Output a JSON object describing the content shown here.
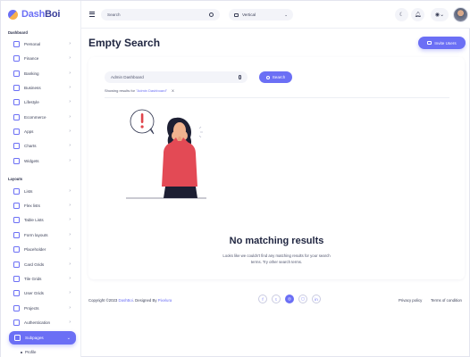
{
  "brand": {
    "name_part1": "Dash",
    "name_part2": "Boi"
  },
  "sidebar": {
    "section_dashboard": "Dashboard",
    "dashboard_items": [
      {
        "label": "Personal",
        "icon": "home-icon"
      },
      {
        "label": "Finance",
        "icon": "finance-icon"
      },
      {
        "label": "Banking",
        "icon": "bank-icon"
      },
      {
        "label": "Business",
        "icon": "briefcase-icon"
      },
      {
        "label": "Lifestyle",
        "icon": "lifestyle-icon"
      },
      {
        "label": "Ecommerce",
        "icon": "cart-icon"
      },
      {
        "label": "Apps",
        "icon": "apps-icon"
      },
      {
        "label": "Charts",
        "icon": "chart-icon"
      },
      {
        "label": "Widgets",
        "icon": "widget-icon"
      }
    ],
    "section_layouts": "Layouts",
    "layout_items": [
      {
        "label": "Lists",
        "icon": "list-icon"
      },
      {
        "label": "Flex lists",
        "icon": "flex-list-icon"
      },
      {
        "label": "Table Lists",
        "icon": "table-icon"
      },
      {
        "label": "Form layouts",
        "icon": "form-icon"
      },
      {
        "label": "Placeholder",
        "icon": "placeholder-icon"
      },
      {
        "label": "Card Grids",
        "icon": "card-grid-icon"
      },
      {
        "label": "Tile Grids",
        "icon": "tile-grid-icon"
      },
      {
        "label": "User Grids",
        "icon": "user-grid-icon"
      },
      {
        "label": "Projects",
        "icon": "project-icon"
      },
      {
        "label": "Authentication",
        "icon": "auth-icon"
      }
    ],
    "active_item": "Subpages",
    "sub_item": "Profile"
  },
  "topbar": {
    "search_placeholder": "Search",
    "layout_select": "Vertical"
  },
  "page": {
    "title": "Empty Search",
    "invite_button": "Invite Users"
  },
  "search": {
    "query": "Admin Dashboard",
    "button": "Search",
    "showing_prefix": "Showing results for",
    "showing_query": "\"Admin Dashboard\"",
    "clear": "X"
  },
  "empty": {
    "title": "No matching results",
    "description": "Looks like we couldn't find any matching results for your search terms. Try other search terms."
  },
  "footer": {
    "copyright_prefix": "Copyright ©2023",
    "copyright_brand": "DashBoi",
    "copyright_mid": ". Designed By",
    "designer": "Pixelura",
    "privacy": "Privacy policy",
    "terms": "Terms of condition",
    "socials": [
      {
        "icon": "facebook-icon",
        "glyph": "f"
      },
      {
        "icon": "twitter-icon",
        "glyph": "t"
      },
      {
        "icon": "dribbble-icon",
        "glyph": "◎"
      },
      {
        "icon": "instagram-icon",
        "glyph": "◻"
      },
      {
        "icon": "linkedin-icon",
        "glyph": "in"
      }
    ]
  },
  "colors": {
    "accent": "#6b6ff5",
    "text": "#1f2540",
    "background": "#f4f5fb"
  }
}
